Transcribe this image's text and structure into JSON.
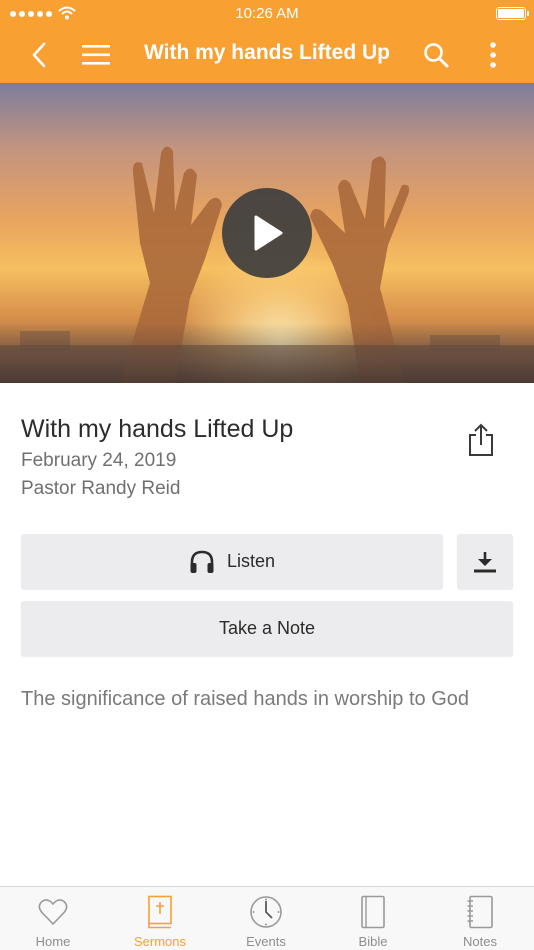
{
  "status_bar": {
    "time": "10:26 AM"
  },
  "nav": {
    "title": "With my hands Lifted Up",
    "back_icon": "chevron-left-icon",
    "menu_icon": "hamburger-menu-icon",
    "search_icon": "search-icon",
    "more_icon": "more-vertical-icon"
  },
  "sermon": {
    "title": "With my hands Lifted Up",
    "date": "February 24, 2019",
    "speaker": "Pastor Randy Reid",
    "description": "The significance of raised hands in worship to God"
  },
  "actions": {
    "listen_label": "Listen",
    "note_label": "Take a Note"
  },
  "tabs": [
    {
      "label": "Home",
      "icon": "heart-icon",
      "active": false
    },
    {
      "label": "Sermons",
      "icon": "book-cross-icon",
      "active": true
    },
    {
      "label": "Events",
      "icon": "clock-icon",
      "active": false
    },
    {
      "label": "Bible",
      "icon": "bible-icon",
      "active": false
    },
    {
      "label": "Notes",
      "icon": "notebook-icon",
      "active": false
    }
  ],
  "colors": {
    "accent": "#f9a033",
    "button_bg": "#ececee",
    "tab_inactive": "#8e8e8e"
  }
}
